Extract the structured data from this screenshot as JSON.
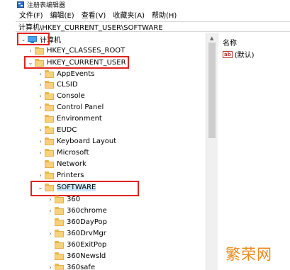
{
  "window": {
    "title": "注册表编辑器"
  },
  "menu": [
    "文件(F)",
    "编辑(E)",
    "查看(V)",
    "收藏夹(A)",
    "帮助(H)"
  ],
  "address": "计算机\\HKEY_CURRENT_USER\\SOFTWARE",
  "tree": {
    "root": "计算机",
    "hives": [
      "HKEY_CLASSES_ROOT",
      "HKEY_CURRENT_USER"
    ],
    "hkcu_children": [
      "AppEvents",
      "CLSID",
      "Console",
      "Control Panel",
      "Environment",
      "EUDC",
      "Keyboard Layout",
      "Microsoft",
      "Network",
      "Printers",
      "SOFTWARE"
    ],
    "software_children": [
      "360",
      "360chrome",
      "360DayPop",
      "360DrvMgr",
      "360ExitPop",
      "360Newsld",
      "360safe"
    ]
  },
  "right_pane": {
    "column_name": "名称",
    "default_value": "(默认)"
  },
  "watermark": "繁荣网",
  "colors": {
    "highlight_box": "#e0231f",
    "folder": "#f6d27a",
    "selection": "#cce8ff"
  }
}
